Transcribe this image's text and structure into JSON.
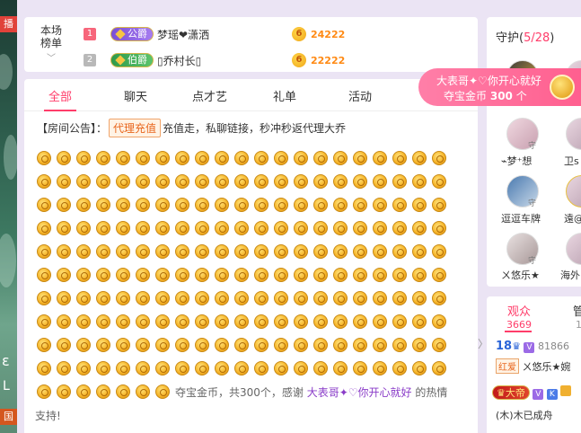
{
  "left_strip": {
    "top_tag": "播",
    "bottom_tag": "国",
    "deco1": "ε",
    "deco2": "ᒪ"
  },
  "leaderboard": {
    "label_line1": "本场",
    "label_line2": "榜单",
    "chevron": "﹀",
    "rows": [
      {
        "rank": "1",
        "noble": "公爵",
        "name": "梦瑶❤潇洒",
        "score": "24222"
      },
      {
        "rank": "2",
        "noble": "伯爵",
        "name": "▯乔村长▯",
        "score": "22222"
      }
    ],
    "coin_glyph": "6"
  },
  "chat": {
    "tabs": [
      "全部",
      "聊天",
      "点才艺",
      "礼单",
      "活动"
    ],
    "active_tab": "全部",
    "notice_prefix": "【房间公告】：",
    "agent_button": "代理充值",
    "notice_text": "充值走，私聊链接，秒冲秒返代理大乔",
    "coin_rows": 11,
    "coin_cols": 21,
    "last_row_coins": 7,
    "thanks_prefix": "夺宝金币，共300个，感谢",
    "thanks_user": "大表哥✦♡你开心就好",
    "thanks_suffix": "的热情",
    "thanks_line2": "支持!"
  },
  "guard": {
    "title": "守护",
    "count": "5/28",
    "members": [
      {
        "name": "⌁梦⁺想",
        "badge": "守"
      },
      {
        "name": "卫s",
        "badge": ""
      },
      {
        "name": "逗逗车牌",
        "badge": "守"
      },
      {
        "name": "遠@",
        "badge": ""
      },
      {
        "name": "ㄨ悠乐★",
        "badge": "守"
      },
      {
        "name": "海外",
        "badge": ""
      }
    ]
  },
  "promo": {
    "line1": "大表哥✦♡你开心就好",
    "line2_prefix": "夺宝金币",
    "line2_amount": "300",
    "line2_suffix": "个"
  },
  "audience": {
    "tab1": "观众",
    "tab1_count": "3669",
    "tab2": "管",
    "tab2_count": "1",
    "arrow": "〉",
    "row1_level": "18",
    "row1_v": "V",
    "row1_score": "81866",
    "row2_tag": "红爱",
    "row2_name": "ㄨ悠乐★婉",
    "row3_title": "大帝",
    "row3_v": "V",
    "row3_k": "K",
    "row4_name": "(木)木已成舟"
  }
}
